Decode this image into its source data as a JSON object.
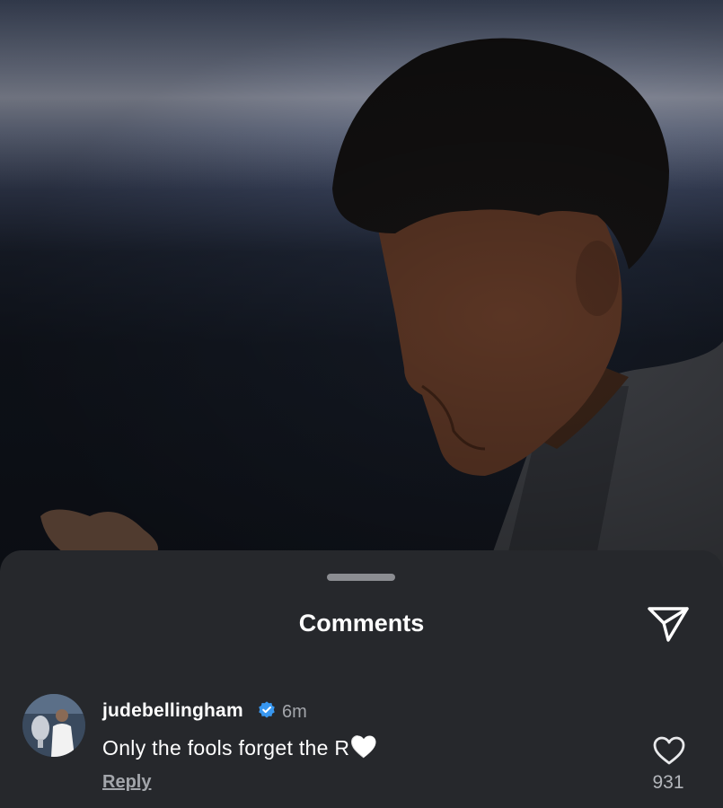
{
  "sheet": {
    "title": "Comments"
  },
  "comment": {
    "username": "judebellingham",
    "verified": true,
    "time": "6m",
    "text": "Only the fools forget the R",
    "text_emoji": "white-heart",
    "reply_label": "Reply",
    "like_count": "931"
  },
  "colors": {
    "sheet_background": "#26282c",
    "verified_blue": "#3897f0",
    "secondary_text": "#a3a6ab"
  },
  "icons": {
    "share": "paper-plane-icon",
    "like": "heart-outline-icon",
    "verified": "verified-badge-icon"
  }
}
